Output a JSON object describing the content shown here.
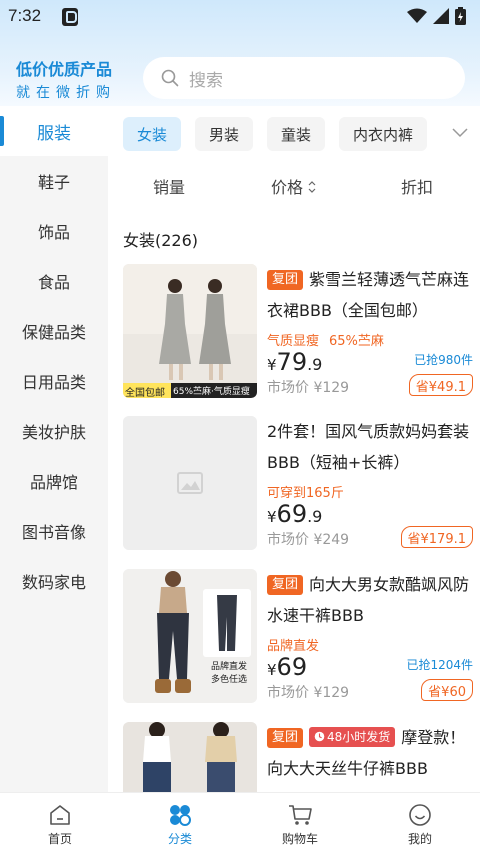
{
  "status_bar": {
    "time": "7:32"
  },
  "brand": {
    "title": "低价优质产品",
    "subtitle": "就在微折购"
  },
  "search": {
    "placeholder": "搜索"
  },
  "sidebar": {
    "items": [
      {
        "label": "服装",
        "active": true
      },
      {
        "label": "鞋子"
      },
      {
        "label": "饰品"
      },
      {
        "label": "食品"
      },
      {
        "label": "保健品类"
      },
      {
        "label": "日用品类"
      },
      {
        "label": "美妆护肤"
      },
      {
        "label": "品牌馆"
      },
      {
        "label": "图书音像"
      },
      {
        "label": "数码家电"
      }
    ]
  },
  "chips": [
    "女装",
    "男装",
    "童装",
    "内衣内裤"
  ],
  "sort": {
    "sales": "销量",
    "price": "价格",
    "discount": "折扣"
  },
  "section": {
    "title": "女装(226)"
  },
  "products": [
    {
      "tag": "复团",
      "title": "紫雪兰轻薄透气芒麻连衣裙BBB（全国包邮）",
      "notes": [
        "气质显瘦",
        "65%苎麻"
      ],
      "price_int": "79",
      "price_dec": ".9",
      "sold": "已抢980件",
      "market_price": "市场价 ¥129",
      "save": "省¥49.1",
      "thumb_caption_left": "全国包邮",
      "thumb_caption_right": "65%苎麻·气质显瘦"
    },
    {
      "title": "2件套！国风气质款妈妈套装BBB（短袖+长裤）",
      "notes": [
        "可穿到165斤"
      ],
      "price_int": "69",
      "price_dec": ".9",
      "sold": "",
      "market_price": "市场价 ¥249",
      "save": "省¥179.1"
    },
    {
      "tag": "复团",
      "title": "向大大男女款酷飒风防水速干裤BBB",
      "notes": [
        "品牌直发"
      ],
      "price_int": "69",
      "price_dec": "",
      "sold": "已抢1204件",
      "market_price": "市场价 ¥129",
      "save": "省¥60",
      "thumb_caption": "品牌直发\n多色任选"
    },
    {
      "tag": "复团",
      "tag2": "48小时发货",
      "title": "摩登款！向大大天丝牛仔裤BBB"
    }
  ],
  "bottom_nav": [
    {
      "label": "首页"
    },
    {
      "label": "分类",
      "active": true
    },
    {
      "label": "购物车"
    },
    {
      "label": "我的"
    }
  ],
  "colors": {
    "accent": "#1a8ad6",
    "orange": "#f06623"
  }
}
